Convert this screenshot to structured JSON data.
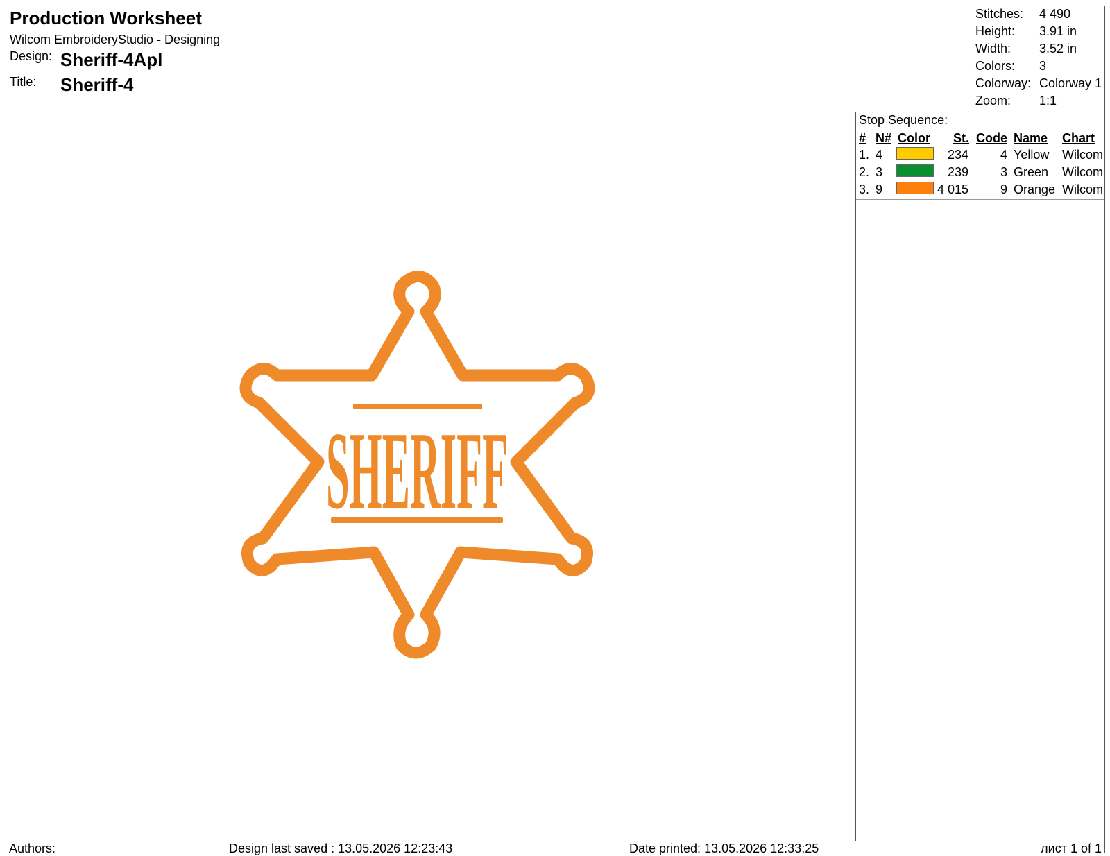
{
  "header": {
    "title": "Production Worksheet",
    "app": "Wilcom EmbroideryStudio - Designing",
    "design_label": "Design:",
    "design_value": "Sheriff-4Apl",
    "title_label": "Title:",
    "title_value": "Sheriff-4"
  },
  "stats": [
    {
      "label": "Stitches:",
      "value": "4 490"
    },
    {
      "label": "Height:",
      "value": "3.91 in"
    },
    {
      "label": "Width:",
      "value": "3.52 in"
    },
    {
      "label": "Colors:",
      "value": "3"
    },
    {
      "label": "Colorway:",
      "value": "Colorway 1"
    },
    {
      "label": "Zoom:",
      "value": "1:1"
    }
  ],
  "stop_sequence": {
    "title": "Stop Sequence:",
    "columns": [
      "#",
      "N#",
      "Color",
      "St.",
      "Code",
      "Name",
      "Chart"
    ],
    "rows": [
      {
        "index": "1.",
        "n": "4",
        "color": "#FFCC00",
        "stitches": "234",
        "code": "4",
        "name": "Yellow",
        "chart": "Wilcom"
      },
      {
        "index": "2.",
        "n": "3",
        "color": "#0A8F2E",
        "stitches": "239",
        "code": "3",
        "name": "Green",
        "chart": "Wilcom"
      },
      {
        "index": "3.",
        "n": "9",
        "color": "#FF7F0E",
        "stitches": "4 015",
        "code": "9",
        "name": "Orange",
        "chart": "Wilcom"
      }
    ]
  },
  "design": {
    "badge_text": "SHERIFF",
    "thread_color": "#EE8A2A"
  },
  "footer": {
    "authors": "Authors:",
    "saved": "Design last saved : 13.05.2026 12:23:43",
    "printed": "Date printed: 13.05.2026 12:33:25",
    "page": "лист 1 of 1"
  }
}
